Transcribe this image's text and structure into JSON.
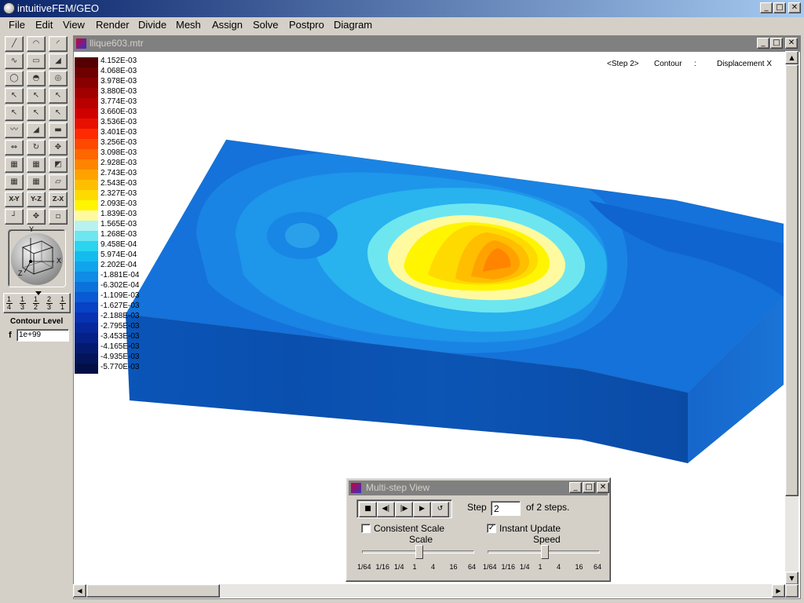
{
  "app": {
    "title": "intuitiveFEM/GEO"
  },
  "menu": [
    "File",
    "Edit",
    "View",
    "Render",
    "Divide",
    "Mesh",
    "Assign",
    "Solve",
    "Postpro",
    "Diagram"
  ],
  "window": {
    "title": "llique603.mtr"
  },
  "header": {
    "step": "<Step 2>",
    "mode": "Contour",
    "sep": ":",
    "quantity": "Displacement X"
  },
  "toolbox": {
    "icons": [
      "line-icon",
      "arc-icon",
      "curve-arc-icon",
      "spline-icon",
      "rectangle-icon",
      "surface-icon",
      "circle-icon",
      "dome-icon",
      "torus-icon",
      "select-arrow-icon",
      "select-edge-icon",
      "select-face-icon",
      "select-node-icon",
      "select-element-icon",
      "select-volume-icon",
      "wave-icon",
      "smooth-surface-icon",
      "contour-select-icon",
      "move-icon",
      "rotate-icon",
      "pan-icon",
      "cube-view-icon",
      "cube-wire-icon",
      "cube-section-icon",
      "mesh-icon",
      "mesh-grid-icon",
      "plane-icon",
      "xy-plane-icon",
      "yz-plane-icon",
      "zx-plane-icon",
      "measure-icon",
      "pan-all-icon",
      "point-icon"
    ],
    "plane_labels": [
      "X-Y",
      "Y-Z",
      "Z-X"
    ],
    "orient": {
      "y": "Y",
      "x": "X",
      "z": "Z"
    },
    "ratios": [
      [
        "1",
        "4"
      ],
      [
        "1",
        "3"
      ],
      [
        "1",
        "2"
      ],
      [
        "2",
        "3"
      ],
      [
        "1",
        "1"
      ]
    ],
    "contour_level_label": "Contour Level",
    "f_label": "f",
    "f_value": "1e+99"
  },
  "chart_data": {
    "type": "heatmap",
    "title": "<Step 2> Contour : Displacement X",
    "legend": {
      "labels": [
        "4.152E-03",
        "4.068E-03",
        "3.978E-03",
        "3.880E-03",
        "3.774E-03",
        "3.660E-03",
        "3.536E-03",
        "3.401E-03",
        "3.256E-03",
        "3.098E-03",
        "2.928E-03",
        "2.743E-03",
        "2.543E-03",
        "2.327E-03",
        "2.093E-03",
        "1.839E-03",
        "1.565E-03",
        "1.268E-03",
        "9.458E-04",
        "5.974E-04",
        "2.202E-04",
        "-1.881E-04",
        "-6.302E-04",
        "-1.109E-03",
        "-1.627E-03",
        "-2.188E-03",
        "-2.795E-03",
        "-3.453E-03",
        "-4.165E-03",
        "-4.935E-03",
        "-5.770E-03"
      ],
      "colors": [
        "#550000",
        "#6e0000",
        "#880000",
        "#a00000",
        "#b80000",
        "#d00000",
        "#e81000",
        "#ff2a00",
        "#ff4800",
        "#ff6600",
        "#ff8400",
        "#ffa200",
        "#ffbe00",
        "#ffda00",
        "#fff500",
        "#fffaa0",
        "#b8f2f0",
        "#6ee6f0",
        "#2bd4ef",
        "#14bcee",
        "#10a4ec",
        "#0e8ce6",
        "#0b72dc",
        "#0a5ad4",
        "#0842c6",
        "#0732b2",
        "#06289c",
        "#052086",
        "#041a70",
        "#03145a",
        "#020f46"
      ]
    },
    "min": -0.00577,
    "max": 0.004152
  },
  "dialog": {
    "title": "Multi-step View",
    "step_label": "Step",
    "step_value": "2",
    "of_steps": "of 2 steps.",
    "consistent_scale": "Consistent Scale",
    "instant_update": "Instant Update",
    "scale_label": "Scale",
    "speed_label": "Speed",
    "scale_ticks": [
      "1/64",
      "1/16",
      "1/4",
      "1",
      "4",
      "16",
      "64"
    ],
    "speed_ticks": [
      "1/64",
      "1/16",
      "1/4",
      "1",
      "4",
      "16",
      "64"
    ],
    "scale_value": "1",
    "speed_value": "1",
    "consistent_checked": false,
    "instant_checked": true
  }
}
